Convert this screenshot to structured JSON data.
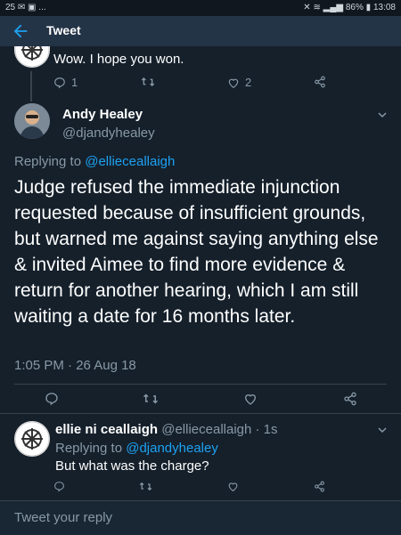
{
  "status_bar": {
    "left_text": "25 ✉ ▣ ...",
    "battery": "86%",
    "time": "13:08"
  },
  "app_bar": {
    "title": "Tweet"
  },
  "prev_tweet": {
    "text": "Wow. I hope you won.",
    "reply_count": "1",
    "like_count": "2"
  },
  "main_tweet": {
    "name": "Andy Healey",
    "handle": "@djandyhealey",
    "replying_label": "Replying to ",
    "replying_to": "@ellieceallaigh",
    "text": "Judge refused the immediate injunction requested because of insufficient grounds, but warned me against saying anything else & invited Aimee to find more evidence & return for another hearing, which I am still waiting a date for 16 months later.",
    "timestamp": "1:05 PM · 26 Aug 18"
  },
  "reply_tweet": {
    "name": "ellie ni ceallaigh",
    "handle_time": "@ellieceallaigh · 1s",
    "replying_label": "Replying to ",
    "replying_to": "@djandyhealey",
    "text": "But what was the charge?"
  },
  "composer": {
    "placeholder": "Tweet your reply"
  },
  "icons": [
    "back-arrow-icon",
    "reply-icon",
    "retweet-icon",
    "like-icon",
    "share-icon",
    "chevron-down-icon"
  ]
}
